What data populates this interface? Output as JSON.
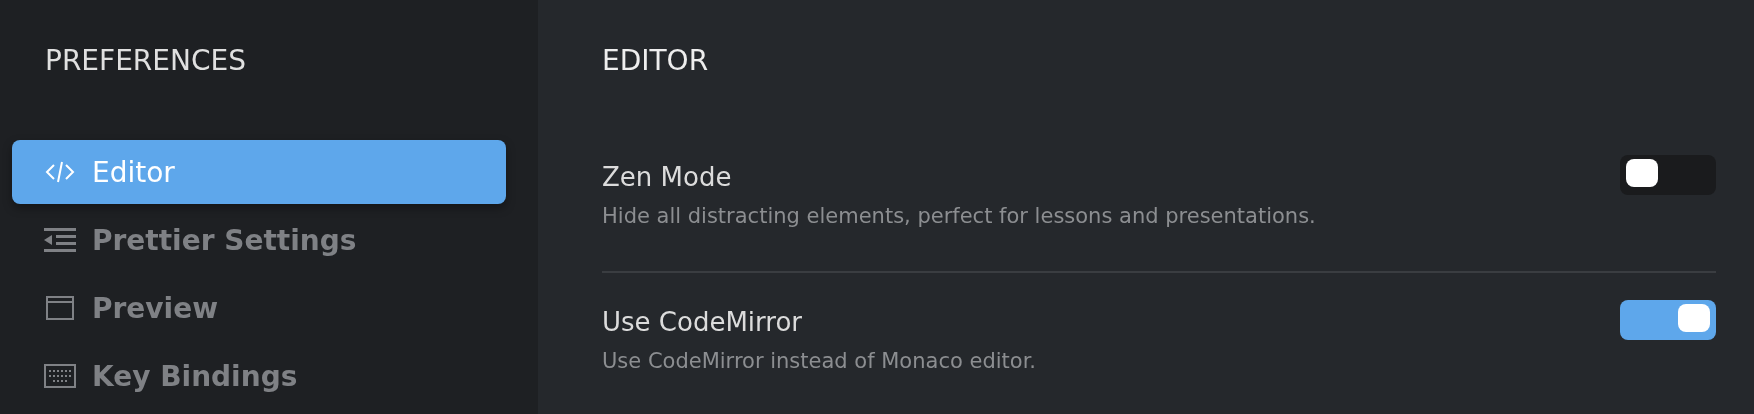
{
  "sidebar": {
    "title": "PREFERENCES",
    "items": [
      {
        "label": "Editor",
        "kind": "code",
        "selected": true
      },
      {
        "label": "Prettier Settings",
        "kind": "indent",
        "selected": false
      },
      {
        "label": "Preview",
        "kind": "window",
        "selected": false
      },
      {
        "label": "Key Bindings",
        "kind": "keyboard",
        "selected": false
      }
    ]
  },
  "section": {
    "title": "EDITOR",
    "settings": [
      {
        "label": "Zen Mode",
        "description": "Hide all distracting elements, perfect for lessons and presentations.",
        "on": false
      },
      {
        "label": "Use CodeMirror",
        "description": "Use CodeMirror instead of Monaco editor.",
        "on": true
      }
    ]
  }
}
